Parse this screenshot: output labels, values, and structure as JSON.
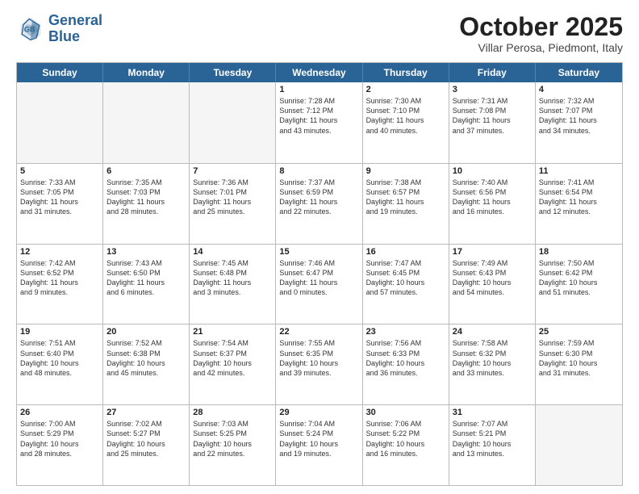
{
  "header": {
    "logo_line1": "General",
    "logo_line2": "Blue",
    "month": "October 2025",
    "location": "Villar Perosa, Piedmont, Italy"
  },
  "days_of_week": [
    "Sunday",
    "Monday",
    "Tuesday",
    "Wednesday",
    "Thursday",
    "Friday",
    "Saturday"
  ],
  "weeks": [
    [
      {
        "day": "",
        "info": [],
        "empty": true
      },
      {
        "day": "",
        "info": [],
        "empty": true
      },
      {
        "day": "",
        "info": [],
        "empty": true
      },
      {
        "day": "1",
        "info": [
          "Sunrise: 7:28 AM",
          "Sunset: 7:12 PM",
          "Daylight: 11 hours",
          "and 43 minutes."
        ]
      },
      {
        "day": "2",
        "info": [
          "Sunrise: 7:30 AM",
          "Sunset: 7:10 PM",
          "Daylight: 11 hours",
          "and 40 minutes."
        ]
      },
      {
        "day": "3",
        "info": [
          "Sunrise: 7:31 AM",
          "Sunset: 7:08 PM",
          "Daylight: 11 hours",
          "and 37 minutes."
        ]
      },
      {
        "day": "4",
        "info": [
          "Sunrise: 7:32 AM",
          "Sunset: 7:07 PM",
          "Daylight: 11 hours",
          "and 34 minutes."
        ]
      }
    ],
    [
      {
        "day": "5",
        "info": [
          "Sunrise: 7:33 AM",
          "Sunset: 7:05 PM",
          "Daylight: 11 hours",
          "and 31 minutes."
        ]
      },
      {
        "day": "6",
        "info": [
          "Sunrise: 7:35 AM",
          "Sunset: 7:03 PM",
          "Daylight: 11 hours",
          "and 28 minutes."
        ]
      },
      {
        "day": "7",
        "info": [
          "Sunrise: 7:36 AM",
          "Sunset: 7:01 PM",
          "Daylight: 11 hours",
          "and 25 minutes."
        ]
      },
      {
        "day": "8",
        "info": [
          "Sunrise: 7:37 AM",
          "Sunset: 6:59 PM",
          "Daylight: 11 hours",
          "and 22 minutes."
        ]
      },
      {
        "day": "9",
        "info": [
          "Sunrise: 7:38 AM",
          "Sunset: 6:57 PM",
          "Daylight: 11 hours",
          "and 19 minutes."
        ]
      },
      {
        "day": "10",
        "info": [
          "Sunrise: 7:40 AM",
          "Sunset: 6:56 PM",
          "Daylight: 11 hours",
          "and 16 minutes."
        ]
      },
      {
        "day": "11",
        "info": [
          "Sunrise: 7:41 AM",
          "Sunset: 6:54 PM",
          "Daylight: 11 hours",
          "and 12 minutes."
        ]
      }
    ],
    [
      {
        "day": "12",
        "info": [
          "Sunrise: 7:42 AM",
          "Sunset: 6:52 PM",
          "Daylight: 11 hours",
          "and 9 minutes."
        ]
      },
      {
        "day": "13",
        "info": [
          "Sunrise: 7:43 AM",
          "Sunset: 6:50 PM",
          "Daylight: 11 hours",
          "and 6 minutes."
        ]
      },
      {
        "day": "14",
        "info": [
          "Sunrise: 7:45 AM",
          "Sunset: 6:48 PM",
          "Daylight: 11 hours",
          "and 3 minutes."
        ]
      },
      {
        "day": "15",
        "info": [
          "Sunrise: 7:46 AM",
          "Sunset: 6:47 PM",
          "Daylight: 11 hours",
          "and 0 minutes."
        ]
      },
      {
        "day": "16",
        "info": [
          "Sunrise: 7:47 AM",
          "Sunset: 6:45 PM",
          "Daylight: 10 hours",
          "and 57 minutes."
        ]
      },
      {
        "day": "17",
        "info": [
          "Sunrise: 7:49 AM",
          "Sunset: 6:43 PM",
          "Daylight: 10 hours",
          "and 54 minutes."
        ]
      },
      {
        "day": "18",
        "info": [
          "Sunrise: 7:50 AM",
          "Sunset: 6:42 PM",
          "Daylight: 10 hours",
          "and 51 minutes."
        ]
      }
    ],
    [
      {
        "day": "19",
        "info": [
          "Sunrise: 7:51 AM",
          "Sunset: 6:40 PM",
          "Daylight: 10 hours",
          "and 48 minutes."
        ]
      },
      {
        "day": "20",
        "info": [
          "Sunrise: 7:52 AM",
          "Sunset: 6:38 PM",
          "Daylight: 10 hours",
          "and 45 minutes."
        ]
      },
      {
        "day": "21",
        "info": [
          "Sunrise: 7:54 AM",
          "Sunset: 6:37 PM",
          "Daylight: 10 hours",
          "and 42 minutes."
        ]
      },
      {
        "day": "22",
        "info": [
          "Sunrise: 7:55 AM",
          "Sunset: 6:35 PM",
          "Daylight: 10 hours",
          "and 39 minutes."
        ]
      },
      {
        "day": "23",
        "info": [
          "Sunrise: 7:56 AM",
          "Sunset: 6:33 PM",
          "Daylight: 10 hours",
          "and 36 minutes."
        ]
      },
      {
        "day": "24",
        "info": [
          "Sunrise: 7:58 AM",
          "Sunset: 6:32 PM",
          "Daylight: 10 hours",
          "and 33 minutes."
        ]
      },
      {
        "day": "25",
        "info": [
          "Sunrise: 7:59 AM",
          "Sunset: 6:30 PM",
          "Daylight: 10 hours",
          "and 31 minutes."
        ]
      }
    ],
    [
      {
        "day": "26",
        "info": [
          "Sunrise: 7:00 AM",
          "Sunset: 5:29 PM",
          "Daylight: 10 hours",
          "and 28 minutes."
        ]
      },
      {
        "day": "27",
        "info": [
          "Sunrise: 7:02 AM",
          "Sunset: 5:27 PM",
          "Daylight: 10 hours",
          "and 25 minutes."
        ]
      },
      {
        "day": "28",
        "info": [
          "Sunrise: 7:03 AM",
          "Sunset: 5:25 PM",
          "Daylight: 10 hours",
          "and 22 minutes."
        ]
      },
      {
        "day": "29",
        "info": [
          "Sunrise: 7:04 AM",
          "Sunset: 5:24 PM",
          "Daylight: 10 hours",
          "and 19 minutes."
        ]
      },
      {
        "day": "30",
        "info": [
          "Sunrise: 7:06 AM",
          "Sunset: 5:22 PM",
          "Daylight: 10 hours",
          "and 16 minutes."
        ]
      },
      {
        "day": "31",
        "info": [
          "Sunrise: 7:07 AM",
          "Sunset: 5:21 PM",
          "Daylight: 10 hours",
          "and 13 minutes."
        ]
      },
      {
        "day": "",
        "info": [],
        "empty": true,
        "shaded": true
      }
    ]
  ]
}
